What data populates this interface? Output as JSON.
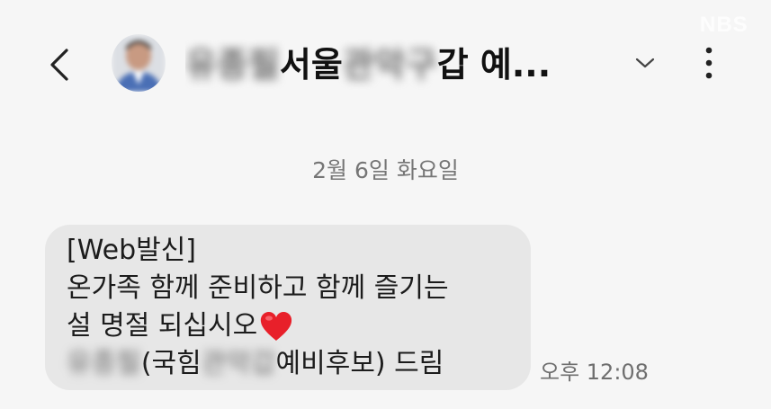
{
  "header": {
    "name_part_blurred_1": "유종필",
    "name_part_1": " 서울",
    "name_part_blurred_2": "관악구",
    "name_part_2": "갑 예...",
    "watermark": "NBS"
  },
  "conversation": {
    "date_separator": "2월 6일 화요일"
  },
  "message": {
    "line1": "[Web발신]",
    "line2": "온가족 함께 준비하고 함께 즐기는",
    "line3": "설 명절 되십시오",
    "line4_blurred_a": "유종필",
    "line4_a": "(국힘 ",
    "line4_blurred_b": "관악갑",
    "line4_b": " 예비후보) 드림",
    "time": "오후 12:08"
  },
  "icons": {
    "back": "back-arrow-icon",
    "expand": "chevron-down-icon",
    "more": "more-vertical-icon",
    "heart": "heart-icon"
  },
  "colors": {
    "background": "#f6f6f6",
    "bubble": "#e7e7e7",
    "heart": "#e8202a",
    "secondary_text": "#767676"
  }
}
